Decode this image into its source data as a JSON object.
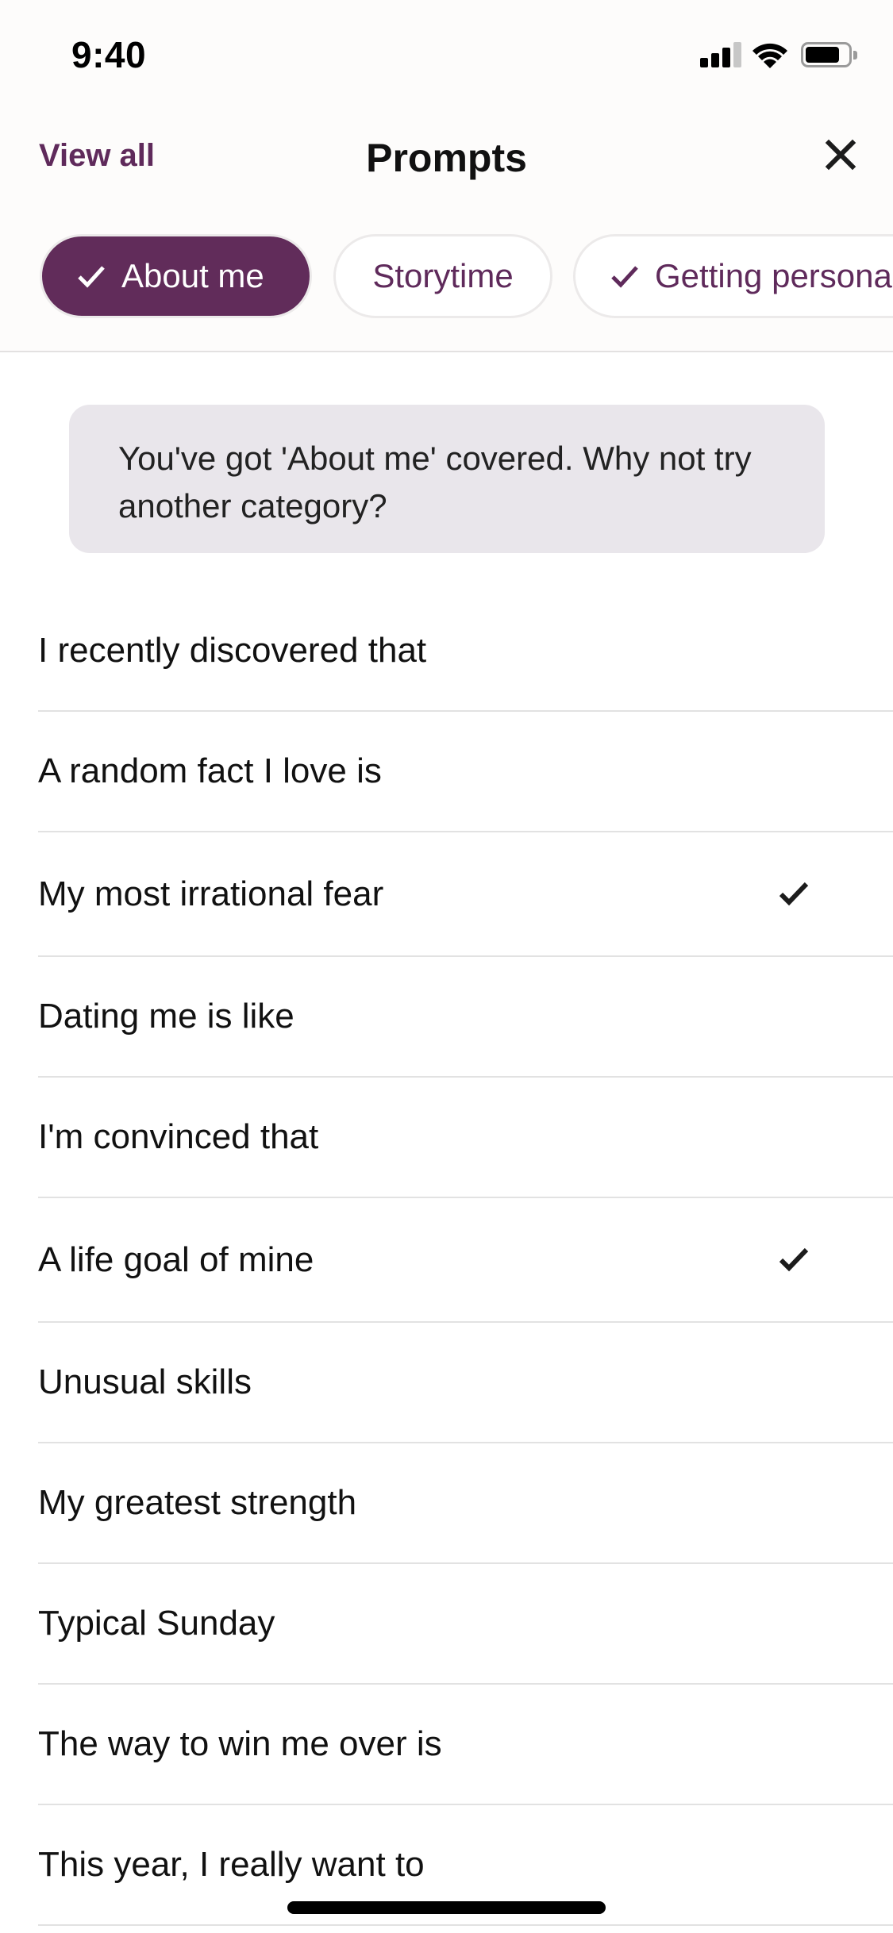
{
  "status_bar": {
    "time": "9:40",
    "signal_bars_total": 4,
    "signal_bars_active": 3,
    "battery_level": 0.8,
    "icons": [
      "cellular-signal-icon",
      "wifi-icon",
      "battery-icon"
    ]
  },
  "header": {
    "view_all_label": "View all",
    "title": "Prompts",
    "close_icon": "close-icon"
  },
  "categories": [
    {
      "label": "About me",
      "selected": true,
      "completed": true
    },
    {
      "label": "Storytime",
      "selected": false,
      "completed": false
    },
    {
      "label": "Getting personal",
      "selected": false,
      "completed": true
    }
  ],
  "banner": {
    "text": "You've got 'About me' covered. Why not try another category?"
  },
  "prompts": [
    {
      "label": "I recently discovered that",
      "checked": false
    },
    {
      "label": "A random fact I love is",
      "checked": false
    },
    {
      "label": "My most irrational fear",
      "checked": true
    },
    {
      "label": "Dating me is like",
      "checked": false
    },
    {
      "label": "I'm convinced that",
      "checked": false
    },
    {
      "label": "A life goal of mine",
      "checked": true
    },
    {
      "label": "Unusual skills",
      "checked": false
    },
    {
      "label": "My greatest strength",
      "checked": false
    },
    {
      "label": "Typical Sunday",
      "checked": false
    },
    {
      "label": "The way to win me over is",
      "checked": false
    },
    {
      "label": "This year, I really want to",
      "checked": false
    }
  ],
  "colors": {
    "accent": "#612C5A",
    "accent_text": "#5F2A5B",
    "banner_bg": "#E9E6EB",
    "header_bg": "#FDFCFB",
    "divider": "#E2E2E2"
  }
}
